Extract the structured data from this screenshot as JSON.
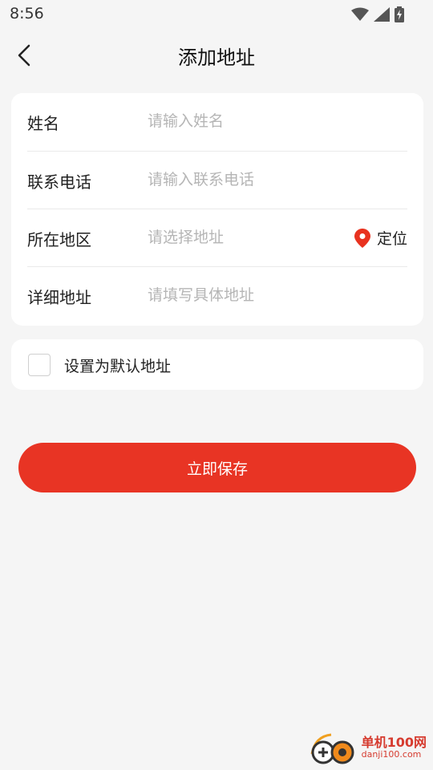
{
  "status_bar": {
    "time": "8:56"
  },
  "nav": {
    "title": "添加地址"
  },
  "form": {
    "fields": [
      {
        "label": "姓名",
        "placeholder": "请输入姓名",
        "value": ""
      },
      {
        "label": "联系电话",
        "placeholder": "请输入联系电话",
        "value": ""
      },
      {
        "label": "所在地区",
        "placeholder": "请选择地址",
        "value": ""
      },
      {
        "label": "详细地址",
        "placeholder": "请填写具体地址",
        "value": ""
      }
    ],
    "locate_label": "定位"
  },
  "default_address": {
    "label": "设置为默认地址",
    "checked": false
  },
  "save_button": {
    "label": "立即保存"
  },
  "watermark": {
    "name": "单机100网",
    "url": "danji100.com"
  },
  "colors": {
    "accent": "#e83424",
    "pin": "#e8321f"
  },
  "icons": [
    "wifi-icon",
    "signal-icon",
    "battery-icon",
    "back-arrow-icon",
    "location-pin-icon"
  ]
}
